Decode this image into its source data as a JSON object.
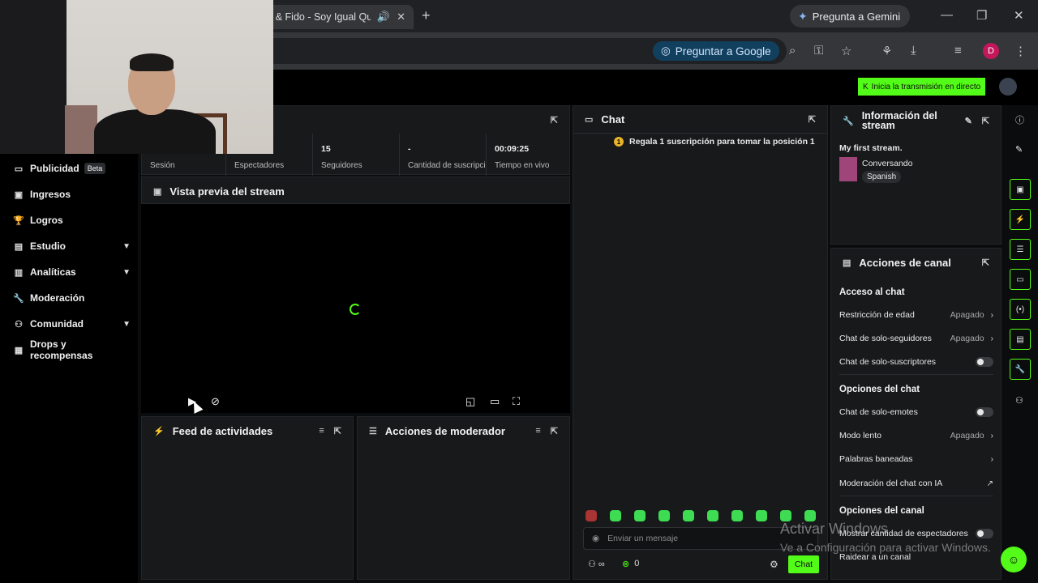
{
  "browser": {
    "tab_title": "s & Fido - Soy Igual Qu",
    "gemini_label": "Pregunta a Gemini",
    "ask_google_label": "Preguntar a Google",
    "profile_initial": "D"
  },
  "header": {
    "go_live_label": "Inicia la transmisión en directo"
  },
  "sidebar": {
    "items": [
      {
        "label": "Publicidad",
        "badge": "Beta",
        "icon": "megaphone-icon"
      },
      {
        "label": "Ingresos",
        "icon": "wallet-icon"
      },
      {
        "label": "Logros",
        "icon": "trophy-icon"
      },
      {
        "label": "Estudio",
        "icon": "layout-icon"
      },
      {
        "label": "Analíticas",
        "icon": "chart-icon"
      },
      {
        "label": "Moderación",
        "icon": "wrench-icon"
      },
      {
        "label": "Comunidad",
        "icon": "community-icon"
      },
      {
        "label": "Drops y recompensas",
        "icon": "gift-icon"
      }
    ]
  },
  "session": {
    "title_fragment": "ión",
    "stats": [
      {
        "value": "",
        "label": "Sesión"
      },
      {
        "value": "",
        "label": "Espectadores"
      },
      {
        "value": "15",
        "label": "Seguidores"
      },
      {
        "value": "-",
        "label": "Cantidad de suscripciones"
      },
      {
        "value": "00:09:25",
        "label": "Tiempo en vivo"
      }
    ]
  },
  "preview": {
    "title": "Vista previa del stream"
  },
  "feed": {
    "title": "Feed de actividades"
  },
  "modactions": {
    "title": "Acciones de moderador"
  },
  "chat": {
    "title": "Chat",
    "pinned": "Regala 1 suscripción para tomar la posición 1",
    "input_placeholder": "Enviar un mensaje",
    "send_label": "Chat",
    "viewer_count": "0"
  },
  "stream_info": {
    "title": "Información del stream",
    "stream_name": "My first stream.",
    "category": "Conversando",
    "language": "Spanish"
  },
  "channel_actions": {
    "title": "Acciones de canal",
    "chat_access_header": "Acceso al chat",
    "age_restriction": {
      "label": "Restricción de edad",
      "value": "Apagado"
    },
    "followers_only": {
      "label": "Chat de solo-seguidores",
      "value": "Apagado"
    },
    "subs_only": {
      "label": "Chat de solo-suscriptores"
    },
    "chat_options_header": "Opciones del chat",
    "emotes_only": {
      "label": "Chat de solo-emotes"
    },
    "slow_mode": {
      "label": "Modo lento",
      "value": "Apagado"
    },
    "banned_words": {
      "label": "Palabras baneadas"
    },
    "ai_moderation": {
      "label": "Moderación del chat con IA"
    },
    "channel_options_header": "Opciones del canal",
    "show_viewers": {
      "label": "Mostrar cantidad de espectadores"
    },
    "raid": {
      "label": "Raidear a un canal"
    }
  },
  "watermark": {
    "line1": "Activar Windows",
    "line2": "Ve a Configuración para activar Windows."
  },
  "colors": {
    "accent": "#53fc18",
    "panel": "#18191b",
    "background": "#000000"
  }
}
